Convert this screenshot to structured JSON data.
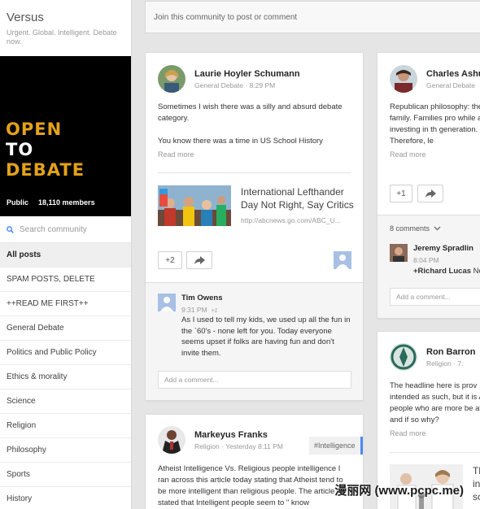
{
  "community": {
    "name": "Versus",
    "tagline": "Urgent. Global. Intelligent. Debate now.",
    "cover_lines": [
      "OPEN",
      "TO",
      "DEBATE"
    ],
    "visibility": "Public",
    "members": "18,110 members"
  },
  "search": {
    "placeholder": "Search community"
  },
  "categories": [
    "All posts",
    "SPAM POSTS, DELETE",
    "++READ ME FIRST++",
    "General Debate",
    "Politics and Public Policy",
    "Ethics & morality",
    "Science",
    "Religion",
    "Philosophy",
    "Sports",
    "History"
  ],
  "join_prompt": "Join this community to post or comment",
  "post1": {
    "author": "Laurie Hoyler Schumann",
    "category": "General Debate",
    "time": "8:29 PM",
    "text1": "Sometimes I wish there was a silly and absurd debate category.",
    "text2": "You know there was a time in US School History",
    "read_more": "Read more",
    "link_title": "International Lefthander Day Not Right, Say Critics",
    "link_url": "http://abcnews.go.com/ABC_U...",
    "plus": "+2",
    "comment": {
      "author": "Tim Owens",
      "time": "9:31 PM",
      "plus": "+1",
      "text": "As I used to tell my kids, we used up all the fun in the `60's - none left for you.  Today everyone seems upset if folks are having fun and don't invite them."
    },
    "add_comment": "Add a comment..."
  },
  "post2": {
    "author": "Charles Ashu",
    "category": "General Debate",
    "text": "Republican philosophy: the family.  Families pro while also investing in th generation.  Therefore, le",
    "read_more": "Read more",
    "plus": "+1",
    "comments_count": "8 comments",
    "comment": {
      "author": "Jeremy Spradlin",
      "time": "8:04 PM",
      "mention": "+Richard Lucas",
      "text": "No"
    },
    "add_comment": "Add a comment..."
  },
  "post3": {
    "author": "Markeyus Franks",
    "category": "Religion",
    "time": "Yesterday 8:11 PM",
    "tag": "#Intelligence",
    "text": "Atheist Intelligence Vs. Religious  people intelligence I ran across this article today stating that Atheist tend to be more intelligent than religious people. The article stated that Intelligent people seem to \" know"
  },
  "post4": {
    "author": "Ron Barron",
    "category": "Religion",
    "time": "7:",
    "text": "The headline here is prov intended as such, but it is Are people who are more be atheist and if so why?",
    "read_more": "Read more",
    "link_title_partial": "Th in sc"
  },
  "watermark": "漫丽网 (www.pcpc.me)",
  "colors": {
    "accent": "#e3a21a",
    "link_blue": "#4a8af4"
  }
}
